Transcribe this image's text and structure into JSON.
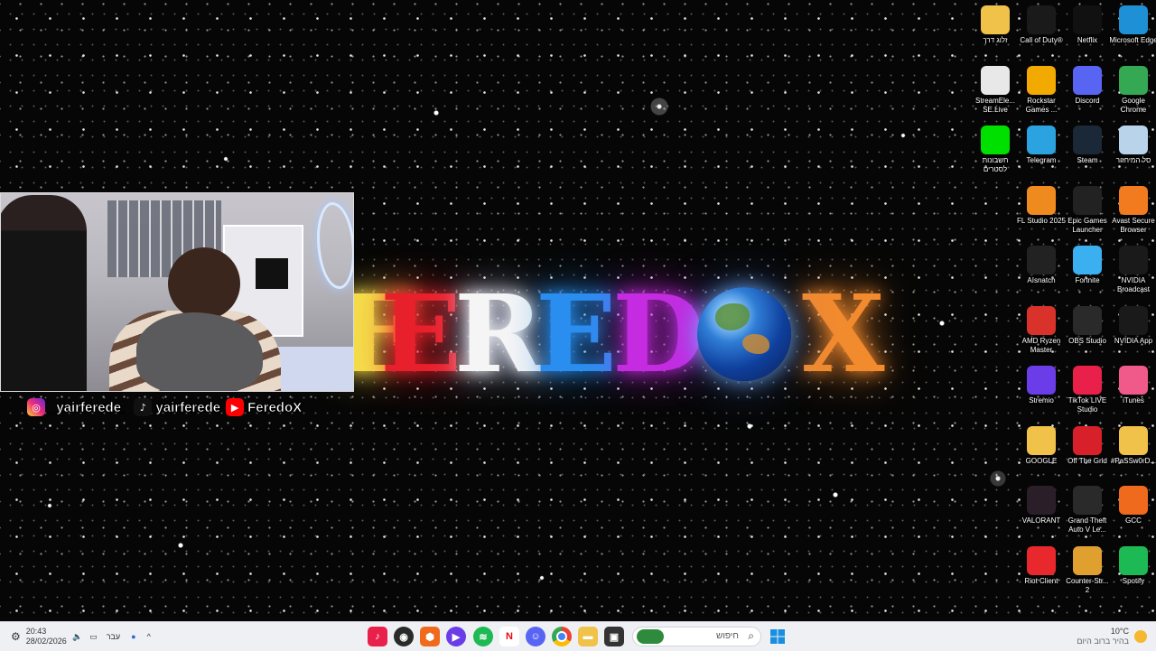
{
  "wallpaper": {
    "logo_letters": [
      {
        "char": "F",
        "color": "#f4e04a"
      },
      {
        "char": "E",
        "color": "#e8202c"
      },
      {
        "char": "R",
        "color": "#f5f5f5"
      },
      {
        "char": "E",
        "color": "#2a8ef0"
      },
      {
        "char": "D",
        "color": "#c52be0"
      },
      {
        "char": "X",
        "color": "#f28a2e"
      }
    ],
    "globe_icon": "earth-globe"
  },
  "webcam_overlay": {
    "socials": [
      {
        "icon": "instagram-icon",
        "text": "_yairferede_",
        "color": "#d6249f"
      },
      {
        "icon": "tiktok-icon",
        "text": "yairferede",
        "color": "#111111"
      },
      {
        "icon": "youtube-icon",
        "text": "FeredoX",
        "color": "#ff0000"
      }
    ]
  },
  "desktop_icons": [
    {
      "label": "זלוג דרך",
      "icon": "folder-icon",
      "color": "#f0c24a"
    },
    {
      "label": "Call of Duty®",
      "icon": "call-of-duty-icon",
      "color": "#1a1a1a"
    },
    {
      "label": "Netflix",
      "icon": "netflix-icon",
      "color": "#111111"
    },
    {
      "label": "Microsoft Edge",
      "icon": "edge-icon",
      "color": "#1e90d6"
    },
    {
      "label": "StreamEle... SE.Live",
      "icon": "streamelements-icon",
      "color": "#e8e8e8"
    },
    {
      "label": "Rockstar Games ...",
      "icon": "rockstar-icon",
      "color": "#f2a900"
    },
    {
      "label": "Discord",
      "icon": "discord-icon",
      "color": "#5865f2"
    },
    {
      "label": "Google Chrome",
      "icon": "chrome-icon",
      "color": "#34a853"
    },
    {
      "label": "חשבונות לסטרים",
      "icon": "green-file-icon",
      "color": "#00e000"
    },
    {
      "label": "Telegram",
      "icon": "telegram-icon",
      "color": "#2aa3e0"
    },
    {
      "label": "Steam",
      "icon": "steam-icon",
      "color": "#1b2838"
    },
    {
      "label": "סל המיחזור",
      "icon": "recycle-bin-icon",
      "color": "#b9d4ea"
    },
    {
      "label": "FL Studio 2025",
      "icon": "fl-studio-icon",
      "color": "#ef8a1e"
    },
    {
      "label": "Epic Games Launcher",
      "icon": "epic-games-icon",
      "color": "#222222"
    },
    {
      "label": "Avast Secure Browser",
      "icon": "avast-icon",
      "color": "#f17b1e"
    },
    {
      "label": "AIsnatch",
      "icon": "aisnatch-icon",
      "color": "#222222"
    },
    {
      "label": "Fortnite",
      "icon": "fortnite-icon",
      "color": "#3ab0f0"
    },
    {
      "label": "NVIDIA Broadcast",
      "icon": "nvidia-broadcast-icon",
      "color": "#1a1a1a"
    },
    {
      "label": "AMD Ryzen Master",
      "icon": "amd-icon",
      "color": "#d8322a"
    },
    {
      "label": "OBS Studio",
      "icon": "obs-icon",
      "color": "#2a2a2a"
    },
    {
      "label": "NVIDIA App",
      "icon": "nvidia-icon",
      "color": "#1a1a1a"
    },
    {
      "label": "Stremio",
      "icon": "stremio-icon",
      "color": "#6a3de8"
    },
    {
      "label": "TikTok LIVE Studio",
      "icon": "tiktok-live-icon",
      "color": "#e8204a"
    },
    {
      "label": "iTunes",
      "icon": "itunes-icon",
      "color": "#f05a8a"
    },
    {
      "label": "GOOGLE",
      "icon": "folder-icon",
      "color": "#f0c24a"
    },
    {
      "label": "Off The Grid",
      "icon": "off-the-grid-icon",
      "color": "#d8202a"
    },
    {
      "label": "#PaSSw0rD...",
      "icon": "folder-icon",
      "color": "#f0c24a"
    },
    {
      "label": "VALORANT",
      "icon": "valorant-icon",
      "color": "#2a1e28"
    },
    {
      "label": "Grand Theft Auto V Le...",
      "icon": "gta-icon",
      "color": "#2a2a2a"
    },
    {
      "label": "GCC",
      "icon": "gcc-icon",
      "color": "#f06a1e"
    },
    {
      "label": "Riot Client",
      "icon": "riot-icon",
      "color": "#e8282c"
    },
    {
      "label": "Counter-Str... 2",
      "icon": "counter-strike-icon",
      "color": "#e0a030"
    },
    {
      "label": "Spotify",
      "icon": "spotify-icon",
      "color": "#1db954"
    }
  ],
  "taskbar": {
    "clock_time": "20:43",
    "clock_date": "28/02/2026",
    "language": "עבר",
    "search_placeholder": "חיפוש",
    "weather_temp": "10°C",
    "weather_text": "בהיר ברוב היום",
    "apps": [
      {
        "name": "tiktok-live-taskbar",
        "icon": "tiktok-live-icon",
        "color": "#e8204a"
      },
      {
        "name": "obs-taskbar",
        "icon": "obs-icon",
        "color": "#2a2a2a"
      },
      {
        "name": "gcc-taskbar",
        "icon": "gcc-icon",
        "color": "#f06a1e"
      },
      {
        "name": "stremio-taskbar",
        "icon": "stremio-icon",
        "color": "#6a3de8"
      },
      {
        "name": "spotify-taskbar",
        "icon": "spotify-icon",
        "color": "#1db954"
      },
      {
        "name": "netflix-taskbar",
        "icon": "netflix-icon",
        "color": "#ffffff"
      },
      {
        "name": "discord-taskbar",
        "icon": "discord-icon",
        "color": "#5865f2"
      },
      {
        "name": "chrome-taskbar",
        "icon": "chrome-icon",
        "color": "#34a853"
      },
      {
        "name": "file-explorer-taskbar",
        "icon": "folder-icon",
        "color": "#f0c24a"
      },
      {
        "name": "task-view-taskbar",
        "icon": "task-view-icon",
        "color": "#333333"
      }
    ]
  }
}
